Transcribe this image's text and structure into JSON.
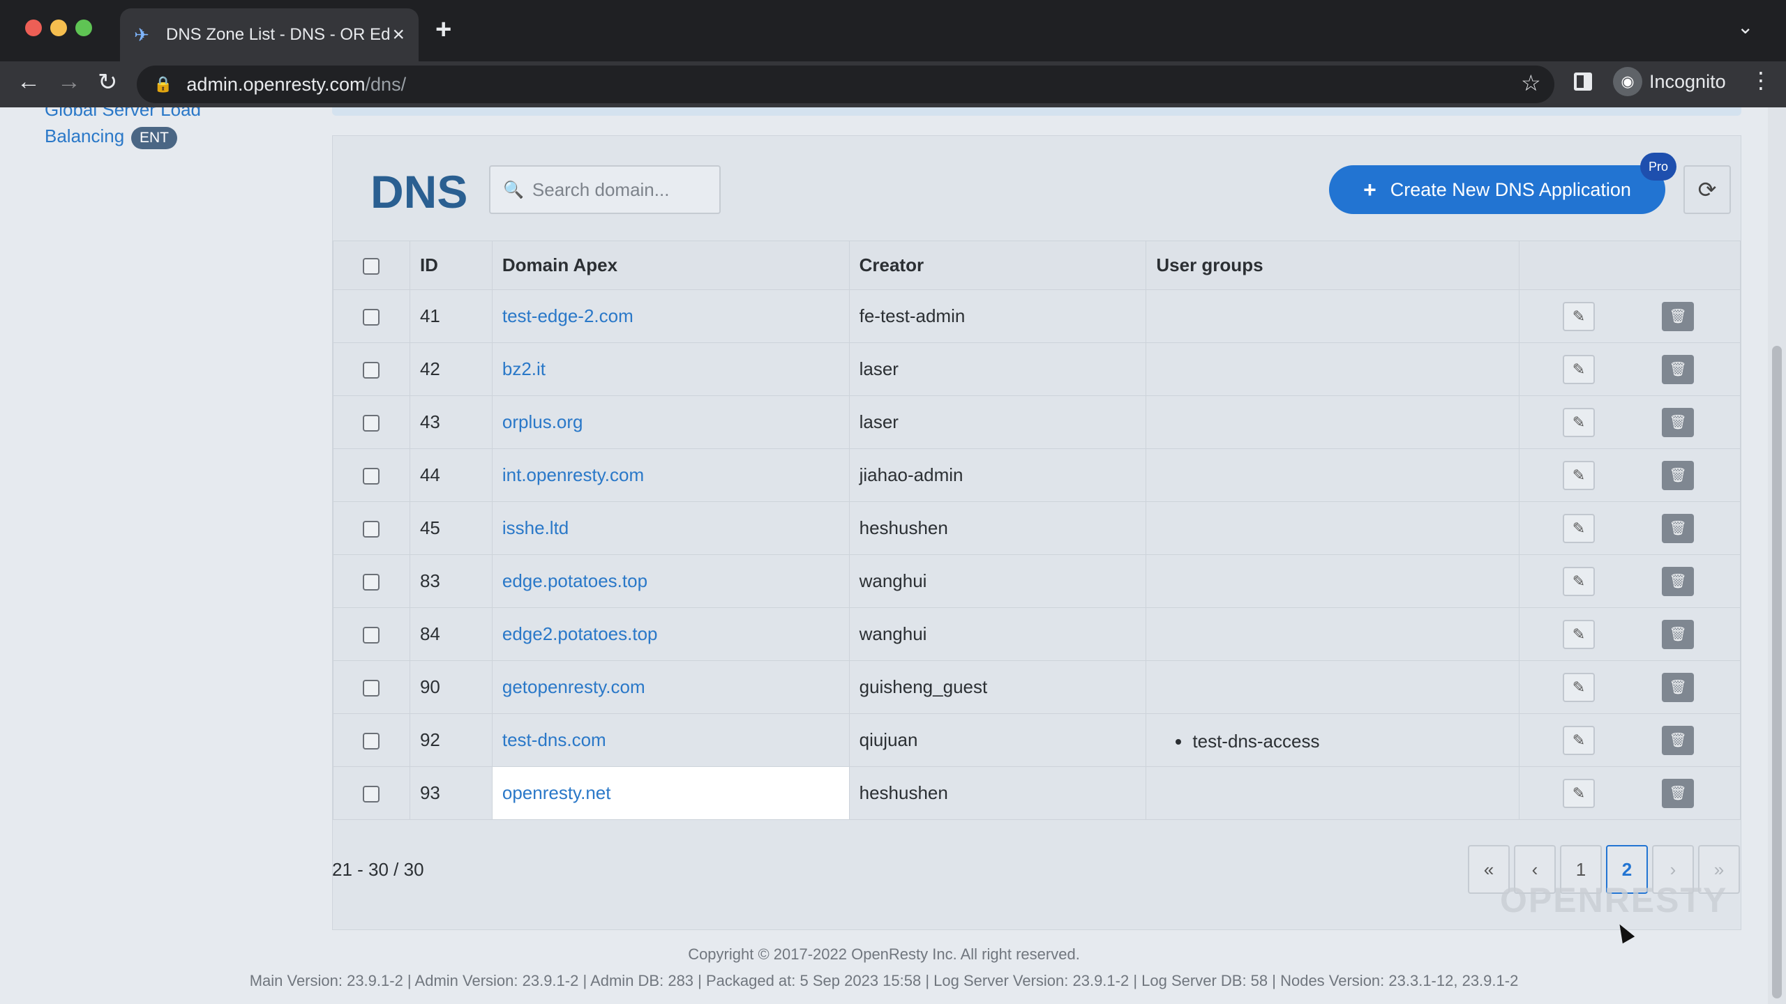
{
  "browser": {
    "tab_title": "DNS Zone List - DNS - OR Edge",
    "url_host": "admin.openresty.com",
    "url_path": "/dns/",
    "profile_label": "Incognito"
  },
  "sidebar": {
    "items": [
      {
        "label": "Global Server Load"
      },
      {
        "label": "Balancing",
        "badge": "ENT"
      }
    ]
  },
  "header": {
    "title": "DNS",
    "search_placeholder": "Search domain...",
    "create_label": "Create New DNS Application",
    "pro_badge": "Pro"
  },
  "table": {
    "columns": [
      "ID",
      "Domain Apex",
      "Creator",
      "User groups"
    ],
    "rows": [
      {
        "id": "41",
        "domain": "test-edge-2.com",
        "creator": "fe-test-admin",
        "groups": ""
      },
      {
        "id": "42",
        "domain": "bz2.it",
        "creator": "laser",
        "groups": ""
      },
      {
        "id": "43",
        "domain": "orplus.org",
        "creator": "laser",
        "groups": ""
      },
      {
        "id": "44",
        "domain": "int.openresty.com",
        "creator": "jiahao-admin",
        "groups": ""
      },
      {
        "id": "45",
        "domain": "isshe.ltd",
        "creator": "heshushen",
        "groups": ""
      },
      {
        "id": "83",
        "domain": "edge.potatoes.top",
        "creator": "wanghui",
        "groups": ""
      },
      {
        "id": "84",
        "domain": "edge2.potatoes.top",
        "creator": "wanghui",
        "groups": ""
      },
      {
        "id": "90",
        "domain": "getopenresty.com",
        "creator": "guisheng_guest",
        "groups": ""
      },
      {
        "id": "92",
        "domain": "test-dns.com",
        "creator": "qiujuan",
        "groups": "test-dns-access"
      },
      {
        "id": "93",
        "domain": "openresty.net",
        "creator": "heshushen",
        "groups": ""
      }
    ]
  },
  "pagination": {
    "range": "21 - 30 / 30",
    "pages": [
      "1",
      "2"
    ],
    "current": "2"
  },
  "footer": {
    "copyright": "Copyright © 2017-2022 OpenResty Inc. All right reserved.",
    "versions": "Main Version: 23.9.1-2 | Admin Version: 23.9.1-2 | Admin DB: 283 | Packaged at: 5 Sep 2023 15:58 | Log Server Version: 23.9.1-2 | Log Server DB: 58 | Nodes Version: 23.3.1-12, 23.9.1-2",
    "watermark": "OPENRESTY"
  },
  "colors": {
    "accent": "#2274d2",
    "link": "#2a78c8",
    "title": "#2a5f91"
  }
}
